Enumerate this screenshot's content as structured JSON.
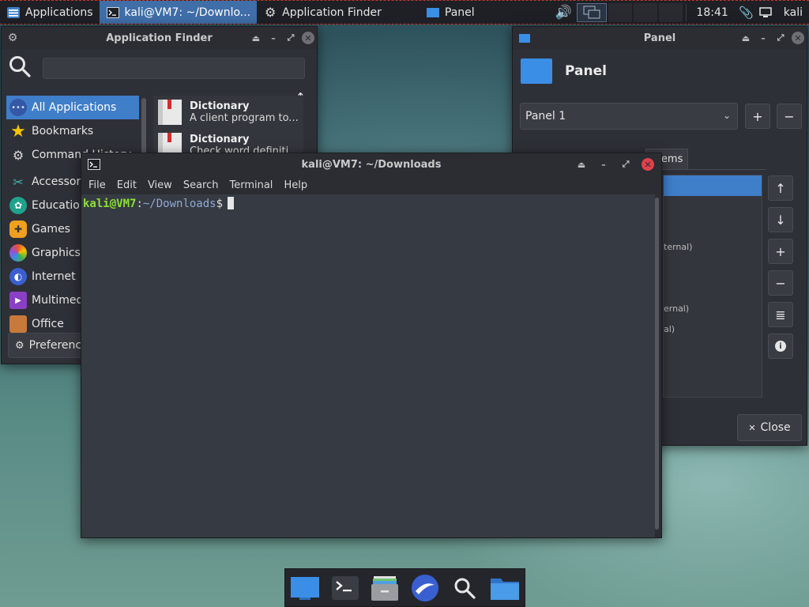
{
  "top_panel": {
    "applications_label": "Applications",
    "tasks": [
      {
        "label": "kali@VM7: ~/Downlo...",
        "active": true
      },
      {
        "label": "Application Finder",
        "active": false
      },
      {
        "label": "Panel",
        "active": false
      }
    ],
    "clock": "18:41",
    "user": "kali"
  },
  "app_finder": {
    "title": "Application Finder",
    "search_value": "",
    "categories": [
      {
        "label": "All Applications",
        "selected": true
      },
      {
        "label": "Bookmarks"
      },
      {
        "label": "Command History"
      },
      {
        "label": "Accessories"
      },
      {
        "label": "Education"
      },
      {
        "label": "Games"
      },
      {
        "label": "Graphics"
      },
      {
        "label": "Internet"
      },
      {
        "label": "Multimedia"
      },
      {
        "label": "Office"
      }
    ],
    "apps": [
      {
        "name": "Dictionary",
        "desc": "A client program to..."
      },
      {
        "name": "Dictionary",
        "desc": "Check word definiti..."
      }
    ],
    "preferences_label": "Preferences"
  },
  "panel_window": {
    "title": "Panel",
    "header": "Panel",
    "panel_select": "Panel 1",
    "tab_label": "Items",
    "list_fragments": [
      "ternal)",
      "ernal)",
      "al)"
    ],
    "close_label": "Close"
  },
  "terminal": {
    "title": "kali@VM7: ~/Downloads",
    "menu": [
      "File",
      "Edit",
      "View",
      "Search",
      "Terminal",
      "Help"
    ],
    "prompt_user": "kali@VM7",
    "prompt_sep": ":",
    "prompt_path": "~/Downloads",
    "prompt_symbol": "$"
  },
  "dock": {
    "items": [
      "desktop-icon",
      "terminal-icon",
      "file-manager-icon",
      "browser-icon",
      "search-icon",
      "folder-icon"
    ]
  },
  "colors": {
    "accent": "#3f7ec9",
    "prompt_user": "#8ae234",
    "prompt_path": "#8fa9d6"
  }
}
